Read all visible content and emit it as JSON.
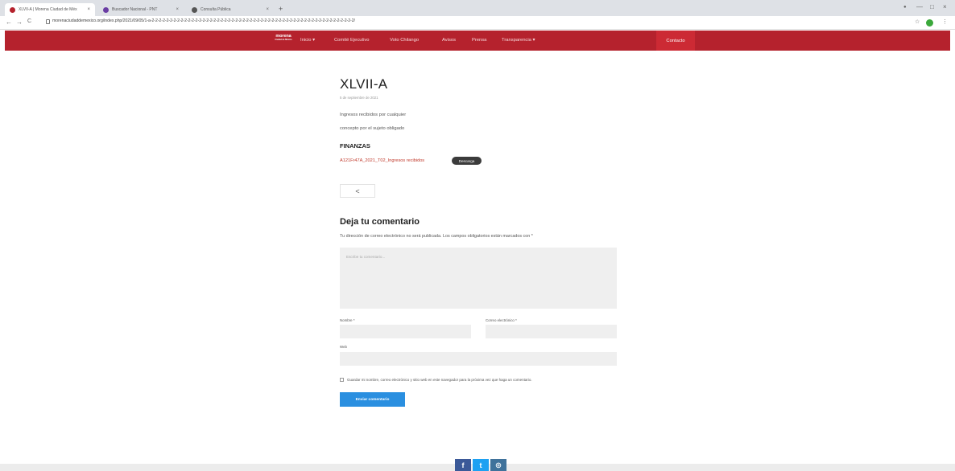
{
  "browser": {
    "tabs": [
      {
        "title": "XLVII-A | Morena Ciudad de Méx",
        "close": "×",
        "favicon_color": "#b5222d"
      },
      {
        "title": "Buscador Nacional - PNT",
        "close": "×",
        "favicon_color": "#6a3da3"
      },
      {
        "title": "Consulta Pública",
        "close": "×",
        "favicon_color": "#555555"
      }
    ],
    "new_tab": "+",
    "window_controls": [
      "—",
      "□",
      "×"
    ],
    "back": "←",
    "forward": "→",
    "reload": "C",
    "url": "morenaciudaddemexico.org/index.php/2021/09/05/1-a-2-2-2-2-2-2-2-2-2-2-2-2-2-2-2-2-2-2-2-2-2-2-2-2-2-2-2-2-2-2-2-2-2-2-2-2-2-2-2-2-2-2-2-2-2-2-2-2-2-2-2-2-2-2-2-2/",
    "star": "☆",
    "menu": "⋮"
  },
  "navbar": {
    "logo_main": "morena",
    "logo_sub": "Ciudad de México",
    "items": [
      {
        "label": "Inicio ▾"
      },
      {
        "label": "Comité Ejecutivo"
      },
      {
        "label": "Voto Chilango"
      },
      {
        "label": "Avisos"
      },
      {
        "label": "Prensa"
      },
      {
        "label": "Transparencia ▾"
      }
    ],
    "contact": "Contacto"
  },
  "post": {
    "title": "XLVII-A",
    "date": "5 de septiembre de 2021",
    "line1": "Ingresos recibidos por cualquier",
    "line2": "concepto por el sujeto obligado",
    "section": "FINANZAS",
    "file_link": "A121Fr47A_2021_T02_Ingresos recibidos",
    "download": "Descarga",
    "back": "<"
  },
  "comments": {
    "title": "Deja tu comentario",
    "note": "Tu dirección de correo electrónico no será publicada. Los campos obligatorios están marcados con *",
    "textarea_placeholder": "Escribe tu comentario...",
    "name_label": "Nombre *",
    "email_label": "Correo electrónico *",
    "web_label": "Web",
    "save_label": "Guardar mi nombre, correo electrónico y sitio web en este navegador para la próxima vez que haga un comentario.",
    "submit": "Enviar comentario"
  },
  "footer": {
    "facebook": "f",
    "twitter": "t",
    "instagram": "◎"
  },
  "colors": {
    "brand_red": "#b5222d",
    "submit_blue": "#2a8fe0",
    "facebook": "#3b5998",
    "twitter": "#1da1f2",
    "instagram": "#3f729b"
  }
}
